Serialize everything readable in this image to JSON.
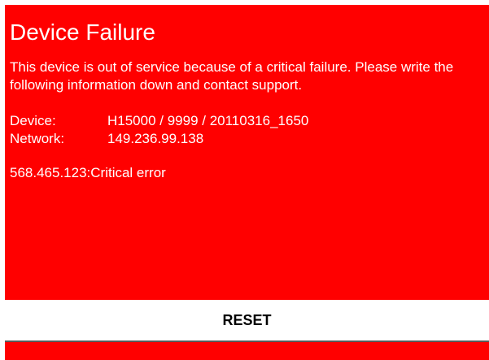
{
  "colors": {
    "panel_background": "#ff0000",
    "text": "#ffffff",
    "button_background": "#ffffff",
    "button_text": "#000000"
  },
  "error": {
    "title": "Device Failure",
    "message": "This device is out of service because of a critical failure. Please write the following information down and contact support.",
    "device_label": "Device:",
    "device_value": "H15000 / 9999 / 20110316_1650",
    "network_label": "Network:",
    "network_value": "149.236.99.138",
    "code": "568.465.123:Critical error"
  },
  "reset_button": {
    "label": "RESET"
  }
}
